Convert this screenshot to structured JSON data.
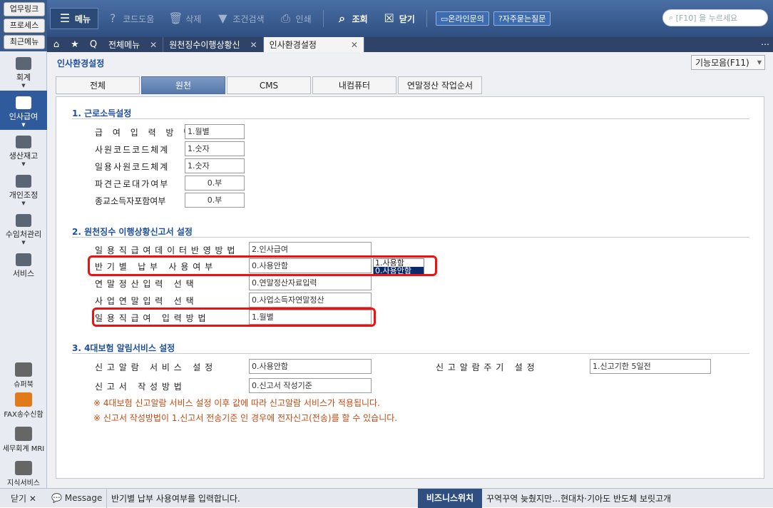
{
  "quicklinks": [
    "업무링크",
    "프로세스",
    "최근메뉴"
  ],
  "toolbar": {
    "menu": "메뉴",
    "code_help": "코드도움",
    "delete": "삭제",
    "conditional_search": "조건검색",
    "print": "인쇄",
    "query": "조회",
    "close": "닫기",
    "online_inquiry": "온라인문의",
    "faq": "자주묻는질문"
  },
  "search": {
    "placeholder": "[F10] 을 누르세요"
  },
  "tabs": [
    "전체메뉴",
    "원천징수이행상황신",
    "인사환경설정"
  ],
  "sidebar": {
    "items": [
      "회계",
      "인사급여",
      "생산재고",
      "개인조정",
      "수임처관리",
      "서비스"
    ],
    "bottom": [
      "슈퍼북",
      "FAX송수신함",
      "세무회계 MRI",
      "지식서비스"
    ]
  },
  "page": {
    "title": "인사환경설정",
    "function_button": "기능모음(F11)",
    "subtabs": [
      "전체",
      "원천",
      "CMS",
      "내컴퓨터",
      "연말정산 작업순서"
    ]
  },
  "section1": {
    "title": "1. 근로소득설정",
    "rows": [
      {
        "label": "급 여 입 력 방 법",
        "value": "1.월별"
      },
      {
        "label": "사원코드코드체계",
        "value": "1.숫자"
      },
      {
        "label": "일용사원코드체계",
        "value": "1.숫자"
      },
      {
        "label": "파견근로대가여부",
        "value": "0.부"
      },
      {
        "label": "종교소득자포함여부",
        "value": "0.부"
      }
    ]
  },
  "section2": {
    "title": "2. 원천징수 이행상황신고서 설정",
    "rows": [
      {
        "label": "일 용 직 급 여 데 이 터 반 영 방 법",
        "value": "2.인사급여"
      },
      {
        "label": "반 기 별   납 부   사 용 여 부",
        "value": "0.사용안함"
      },
      {
        "label": "연 말 정 산 입 력   선 택",
        "value": "0.연말정산자료입력"
      },
      {
        "label": "사 업 연 말 입 력   선 택",
        "value": "0.사업소득자연말정산"
      },
      {
        "label": "일 용 직 급 여   입 력 방 법",
        "value": "1.월별"
      }
    ],
    "dropdown_options": [
      "1.사용함",
      "0.사용안함"
    ]
  },
  "section3": {
    "title": "3. 4대보험 알림서비스 설정",
    "rows": [
      {
        "label": "신 고 알 람   서 비 스   설 정",
        "value": "0.사용안함"
      },
      {
        "label": "신 고 서   작 성 방 법",
        "value": "0.신고서 작성기준"
      }
    ],
    "alarm_cycle": {
      "label": "신 고 알 람 주 기   설 정",
      "value": "1.신고기한 5일전"
    },
    "notes": [
      "※ 4대보험 신고알람 서비스 설정 이후 값에 따라 신고알람 서비스가 적용됩니다.",
      "※ 신고서 작성방법이 1.신고서 전송기준 인 경우에 전자신고(전송)를 할 수 있습니다."
    ]
  },
  "status": {
    "close": "닫기",
    "message_label": "Message",
    "message": "반기별 납부 사용여부를 입력합니다.",
    "biz_label": "비즈니스위치",
    "biz_text": "꾸역꾸역 늦췄지만…현대차·기아도 반도체 보릿고개"
  },
  "colors": {
    "accent": "#1e4fa0",
    "highlight": "#e11111",
    "note": "#c44a13"
  }
}
